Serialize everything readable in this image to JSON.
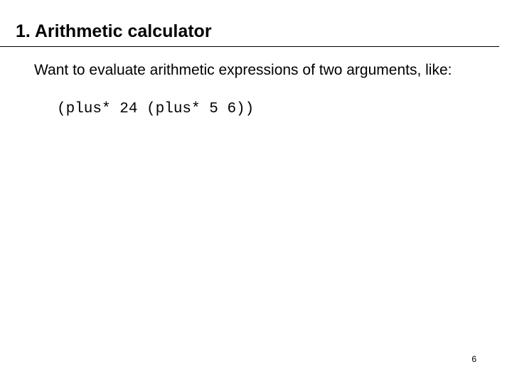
{
  "slide": {
    "heading": "1. Arithmetic calculator",
    "body": "Want to evaluate arithmetic expressions of two arguments, like:",
    "code": "(plus* 24 (plus* 5 6))",
    "page_number": "6"
  }
}
